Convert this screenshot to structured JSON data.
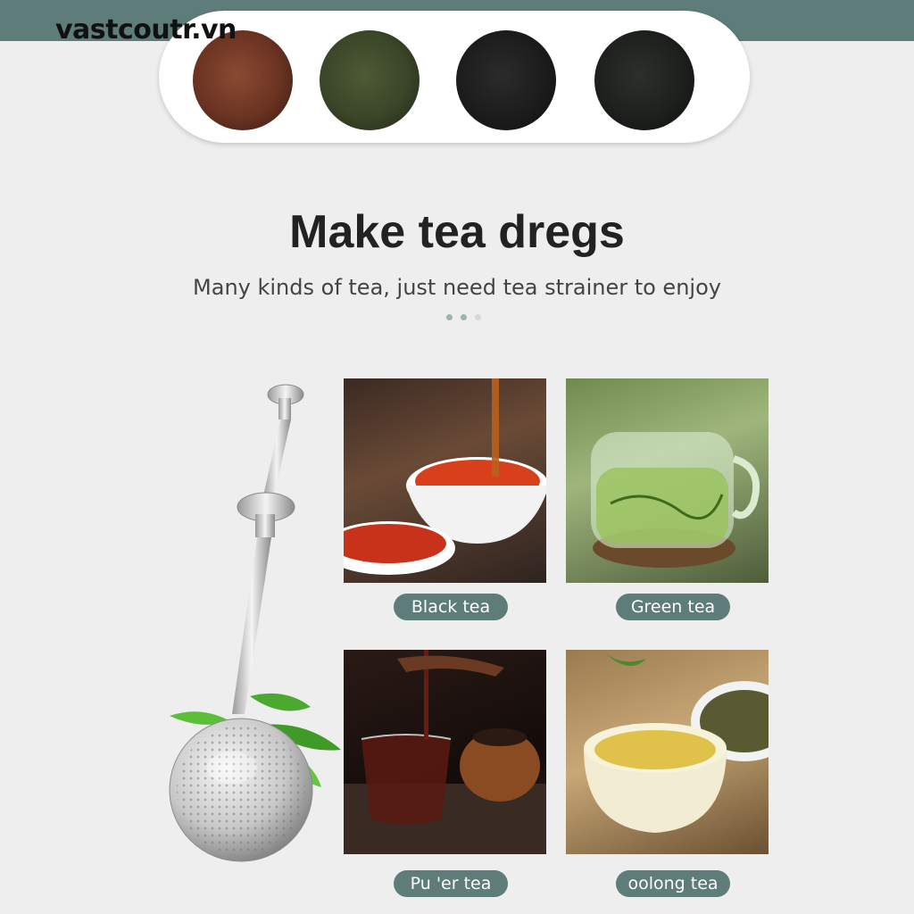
{
  "watermark": "vastcoutr.vn",
  "heading": "Make tea dregs",
  "subheading": "Many kinds of tea, just need tea strainer to enjoy",
  "carousel": {
    "dot_count": 3,
    "active_index": 0
  },
  "teas": [
    {
      "label": "Black tea"
    },
    {
      "label": "Green tea"
    },
    {
      "label": "Pu 'er tea"
    },
    {
      "label": "oolong tea"
    }
  ],
  "colors": {
    "accent": "#5e7c7a",
    "background": "#eeeeee",
    "heading": "#222222"
  }
}
